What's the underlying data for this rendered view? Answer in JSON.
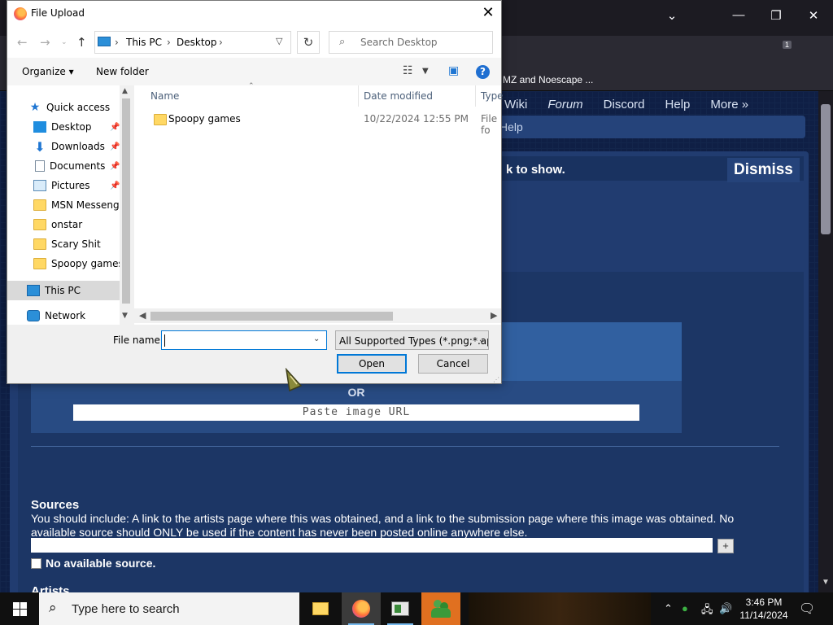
{
  "browser": {
    "bookmark_text": "MZ and Noescape ...",
    "ext_badge": "1",
    "nav": [
      "Wiki",
      "Forum",
      "Discord",
      "Help",
      "More »"
    ],
    "help_fragment": "Help",
    "notice_text": "k to show.",
    "dismiss_label": "Dismiss",
    "or_label": "OR",
    "url_placeholder": "Paste image URL",
    "sources_title": "Sources",
    "sources_desc": "You should include: A link to the artists page where this was obtained, and a link to the submission page where this image was obtained. No available source should ONLY be used if the content has never been posted online anywhere else.",
    "plus_label": "+",
    "no_source_label": "No available source.",
    "artists_title": "Artists"
  },
  "dialog": {
    "title": "File Upload",
    "breadcrumb": [
      "This PC",
      "Desktop"
    ],
    "search_placeholder": "Search Desktop",
    "organize_label": "Organize ▾",
    "new_folder_label": "New folder",
    "nav_pane": [
      {
        "label": "Quick access",
        "icon": "star-icon",
        "pinned": false
      },
      {
        "label": "Desktop",
        "icon": "desktop-icon",
        "pinned": true
      },
      {
        "label": "Downloads",
        "icon": "download-icon",
        "pinned": true
      },
      {
        "label": "Documents",
        "icon": "document-icon",
        "pinned": true
      },
      {
        "label": "Pictures",
        "icon": "pictures-icon",
        "pinned": true
      },
      {
        "label": "MSN Messenger",
        "icon": "folder-icon",
        "pinned": false
      },
      {
        "label": "onstar",
        "icon": "folder-icon",
        "pinned": false
      },
      {
        "label": "Scary Shit",
        "icon": "folder-icon",
        "pinned": false
      },
      {
        "label": "Spoopy games",
        "icon": "folder-icon",
        "pinned": false
      },
      {
        "label": "This PC",
        "icon": "pc-icon",
        "pinned": false,
        "selected": true
      },
      {
        "label": "Network",
        "icon": "network-icon",
        "pinned": false
      }
    ],
    "columns": {
      "name": "Name",
      "date": "Date modified",
      "type": "Type"
    },
    "files": [
      {
        "name": "Spoopy games",
        "date": "10/22/2024 12:55 PM",
        "type": "File fo"
      }
    ],
    "file_name_label": "File name:",
    "file_name_value": "",
    "file_type_value": "All Supported Types (*.png;*.ap",
    "open_label": "Open",
    "cancel_label": "Cancel"
  },
  "taskbar": {
    "search_placeholder": "Type here to search",
    "time": "3:46 PM",
    "date": "11/14/2024"
  }
}
